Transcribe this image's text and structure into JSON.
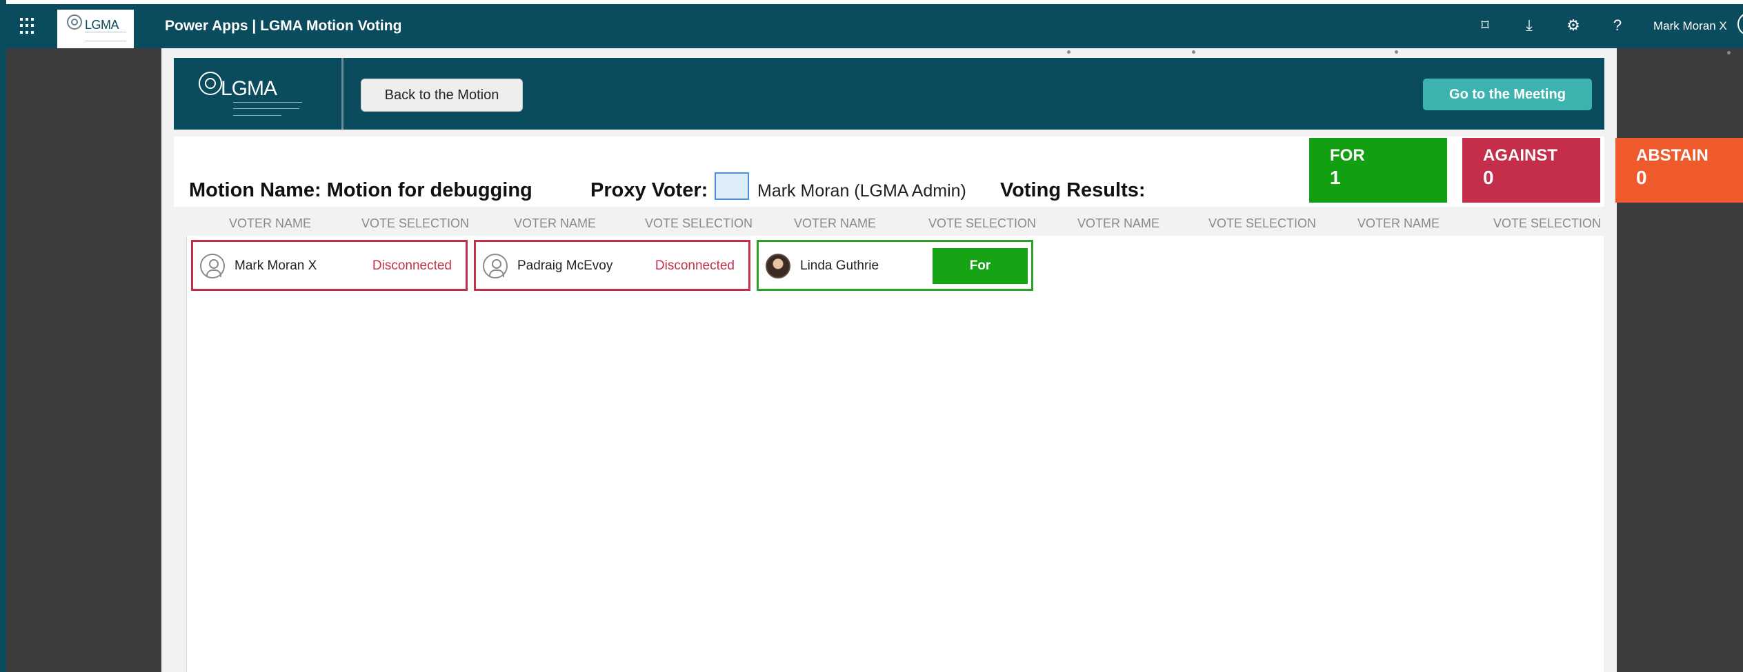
{
  "topbar": {
    "brand_logo_text": "LGMA",
    "title": "Power Apps  |  LGMA Motion Voting",
    "icons": [
      "fit-screen-icon",
      "download-icon",
      "settings-icon",
      "help-icon"
    ],
    "icon_glyphs": [
      "⌑",
      "⤓",
      "⚙",
      "?"
    ],
    "user_name": "Mark Moran X"
  },
  "header": {
    "logo_text": "LGMA",
    "back_button": "Back to the Motion",
    "meeting_button": "Go to the Meeting"
  },
  "info": {
    "motion_label": "Motion Name: Motion for debugging",
    "proxy_label": "Proxy Voter:",
    "proxy_name": "Mark Moran (LGMA Admin)",
    "results_label": "Voting Results:"
  },
  "results": [
    {
      "label": "FOR",
      "value": "1",
      "color": "#12a012"
    },
    {
      "label": "AGAINST",
      "value": "0",
      "color": "#c42e4a"
    },
    {
      "label": "ABSTAIN",
      "value": "0",
      "color": "#ee5a2c"
    }
  ],
  "columns": [
    "VOTER NAME",
    "VOTE SELECTION",
    "VOTER NAME",
    "VOTE SELECTION",
    "VOTER NAME",
    "VOTE SELECTION",
    "VOTER NAME",
    "VOTE SELECTION",
    "VOTER NAME",
    "VOTE SELECTION"
  ],
  "voters": [
    {
      "name": "Mark Moran X",
      "status": "Disconnected",
      "state": "disconnected"
    },
    {
      "name": "Padraig McEvoy",
      "status": "Disconnected",
      "state": "disconnected"
    },
    {
      "name": "Linda  Guthrie",
      "status": "For",
      "state": "voted"
    }
  ],
  "colors": {
    "brand_dark": "#0b4b5e",
    "disconnected": "#c0304a",
    "voted": "#2aa22a",
    "meeting_button": "#3db3b0"
  }
}
